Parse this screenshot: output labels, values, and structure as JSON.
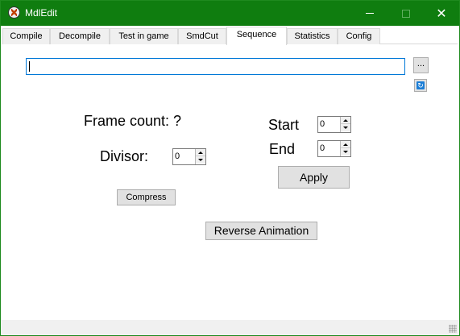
{
  "window": {
    "title": "MdlEdit",
    "controls": {
      "minimize": "—",
      "maximize": "□",
      "close": "✕"
    },
    "app_icon": "half-life-lambda-icon"
  },
  "tabs": [
    {
      "label": "Compile"
    },
    {
      "label": "Decompile"
    },
    {
      "label": "Test in game"
    },
    {
      "label": "SmdCut"
    },
    {
      "label": "Sequence",
      "active": true
    },
    {
      "label": "Statistics"
    },
    {
      "label": "Config"
    }
  ],
  "sequence": {
    "path_value": "",
    "browse_label": "...",
    "refresh_icon": "refresh-icon",
    "frame_count_label": "Frame count: ?",
    "divisor_label": "Divisor:",
    "divisor_value": "0",
    "start_label": "Start",
    "start_value": "0",
    "end_label": "End",
    "end_value": "0",
    "apply_label": "Apply",
    "compress_label": "Compress",
    "reverse_label": "Reverse Animation"
  },
  "colors": {
    "titlebar": "#0f7d0f",
    "focus_border": "#0078d7",
    "button_face": "#e1e1e1"
  }
}
